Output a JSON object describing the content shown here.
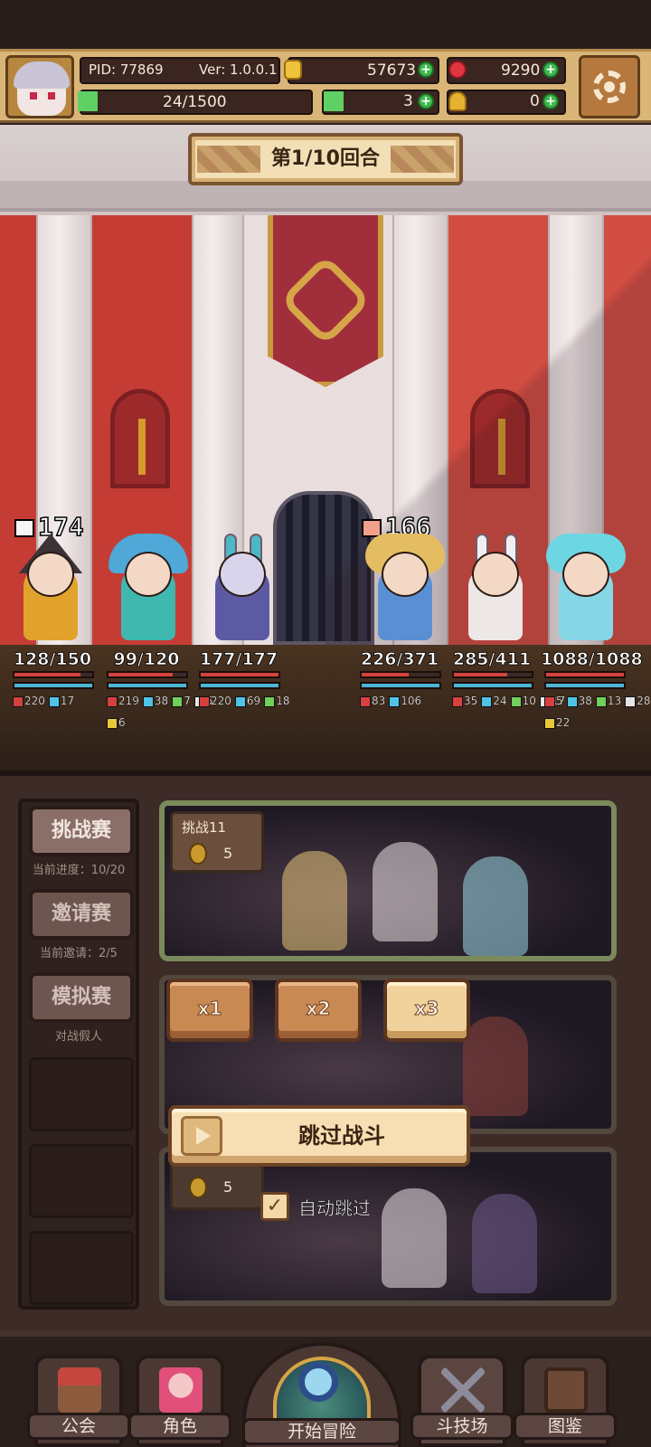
{
  "header": {
    "pid_label": "PID: 77869",
    "version_label": "Ver: 1.0.0.1",
    "gold": "57673",
    "gems": "9290",
    "stamina": "24/1500",
    "clover": "3",
    "gold_bag": "0",
    "icons": [
      "avatar",
      "gold-coin-icon",
      "red-gem-icon",
      "clover-icon",
      "gold-bag-icon",
      "settings-gear-icon"
    ]
  },
  "battle": {
    "round_label": "第1/10回合",
    "ally_total": "174",
    "enemy_total": "166",
    "allies": [
      {
        "hp": "128/150",
        "hp_frac": 0.85,
        "buffs": [
          "220",
          "17"
        ],
        "buffs2": []
      },
      {
        "hp": "99/120",
        "hp_frac": 0.83,
        "buffs": [
          "219",
          "38",
          "7",
          "5"
        ],
        "buffs2": [
          "6"
        ]
      },
      {
        "hp": "177/177",
        "hp_frac": 1.0,
        "buffs": [
          "220",
          "69",
          "18"
        ],
        "buffs2": []
      }
    ],
    "enemies": [
      {
        "hp": "226/371",
        "hp_frac": 0.61,
        "buffs": [
          "83",
          "106"
        ],
        "buffs2": []
      },
      {
        "hp": "285/411",
        "hp_frac": 0.69,
        "buffs": [
          "35",
          "24",
          "10",
          "17"
        ],
        "buffs2": []
      },
      {
        "hp": "1088/1088",
        "hp_frac": 1.0,
        "buffs": [
          "5",
          "38",
          "13",
          "28"
        ],
        "buffs2": [
          "22"
        ]
      }
    ],
    "colors": {
      "hp": "#d4443c",
      "mp": "#4cb6d4"
    }
  },
  "arena": {
    "tabs": [
      {
        "label": "挑战赛",
        "sub": "当前进度：10/20"
      },
      {
        "label": "邀请赛",
        "sub": "当前邀请：2/5"
      },
      {
        "label": "模拟赛",
        "sub": "对战假人"
      }
    ],
    "cards": [
      {
        "title": "挑战11",
        "cost": "5"
      },
      {
        "title": "",
        "cost": "5"
      }
    ],
    "speed": [
      "x1",
      "x2",
      "x3"
    ],
    "speed_selected": "x3",
    "skip_label": "跳过战斗",
    "auto_skip_label": "自动跳过",
    "auto_skip_checked": true,
    "check_mark": "✓"
  },
  "nav": {
    "items": [
      "公会",
      "角色",
      "开始冒险",
      "斗技场",
      "图鉴"
    ]
  }
}
